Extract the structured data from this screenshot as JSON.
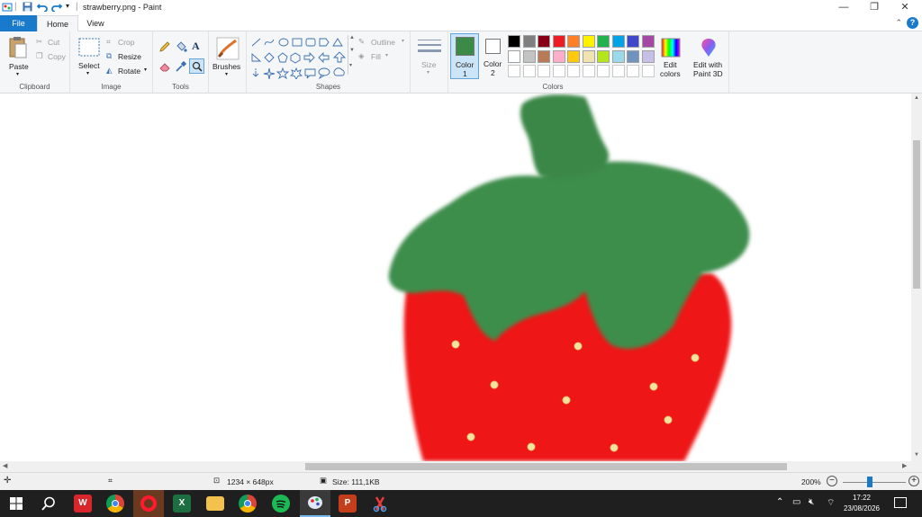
{
  "window": {
    "title": "strawberry.png - Paint",
    "minimize": "—",
    "restore": "❐",
    "close": "✕"
  },
  "tabs": [
    {
      "label": "File",
      "active": false
    },
    {
      "label": "Home",
      "active": true
    },
    {
      "label": "View",
      "active": false
    }
  ],
  "ribbon": {
    "clipboard": {
      "group": "Clipboard",
      "paste": "Paste",
      "cut": "Cut",
      "copy": "Copy"
    },
    "image": {
      "group": "Image",
      "select": "Select",
      "crop": "Crop",
      "resize": "Resize",
      "rotate": "Rotate"
    },
    "tools": {
      "group": "Tools"
    },
    "brushes": {
      "label": "Brushes"
    },
    "shapes": {
      "group": "Shapes",
      "outline": "Outline",
      "fill": "Fill"
    },
    "size": {
      "label": "Size"
    },
    "colors": {
      "group": "Colors",
      "color1": "Color 1",
      "color1_line1": "Color",
      "color1_line2": "1",
      "color1_value": "#3c8a47",
      "color2_line1": "Color",
      "color2_line2": "2",
      "color2_value": "#ffffff",
      "edit_line1": "Edit",
      "edit_line2": "colors",
      "paint3d_line1": "Edit with",
      "paint3d_line2": "Paint 3D",
      "palette_row1": [
        "#000000",
        "#7f7f7f",
        "#880015",
        "#ed1c24",
        "#ff7f27",
        "#fff200",
        "#22b14c",
        "#00a2e8",
        "#3f48cc",
        "#a349a4"
      ],
      "palette_row2": [
        "#ffffff",
        "#c3c3c3",
        "#b97a57",
        "#ffaec9",
        "#ffc90e",
        "#efe4b0",
        "#b5e61d",
        "#99d9ea",
        "#7092be",
        "#c8bfe7"
      ]
    }
  },
  "status": {
    "dimensions": "1234 × 648px",
    "size": "Size: 111,1KB",
    "zoom": "200%",
    "zoom_fraction": 0.43
  },
  "taskbar": {
    "time": "17:22",
    "date": "23/08/2026",
    "apps": [
      "wps-icon",
      "chrome-icon",
      "opera-icon",
      "excel-icon",
      "file-explorer-icon",
      "chrome-profile-icon",
      "spotify-icon",
      "paint-icon",
      "powerpoint-icon",
      "snipping-tool-icon"
    ]
  }
}
